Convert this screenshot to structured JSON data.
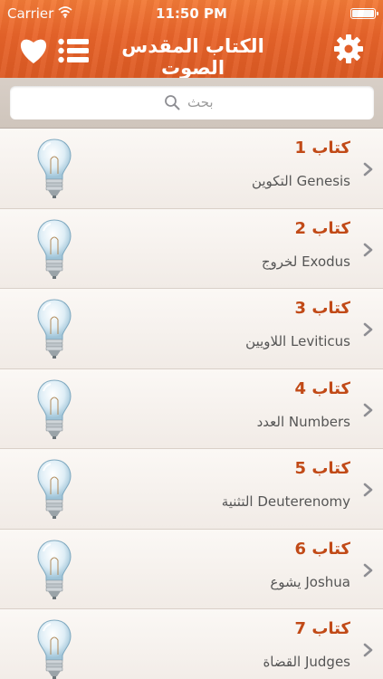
{
  "status_bar": {
    "carrier": "Carrier",
    "time": "11:50 PM"
  },
  "nav": {
    "title": "الكتاب المقدس الصوت",
    "icons": [
      "heart-icon",
      "list-icon",
      "gear-icon"
    ]
  },
  "search": {
    "placeholder": "بحث"
  },
  "colors": {
    "accent": "#e8642a",
    "title_text": "#c14a17"
  },
  "books": [
    {
      "title": "كتاب 1",
      "subtitle": "التكوين Genesis"
    },
    {
      "title": "كتاب 2",
      "subtitle": "لخروج Exodus"
    },
    {
      "title": "كتاب 3",
      "subtitle": "اللاويين Leviticus"
    },
    {
      "title": "كتاب 4",
      "subtitle": "العدد Numbers"
    },
    {
      "title": "كتاب 5",
      "subtitle": "التثنية Deuterenomy"
    },
    {
      "title": "كتاب 6",
      "subtitle": "يشوع Joshua"
    },
    {
      "title": "كتاب 7",
      "subtitle": "القضاة Judges"
    }
  ]
}
